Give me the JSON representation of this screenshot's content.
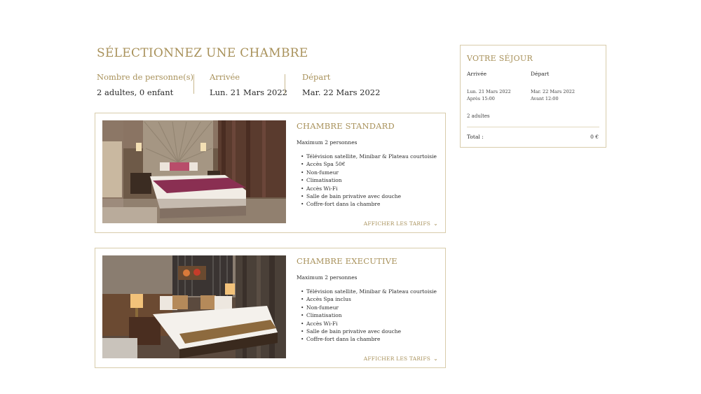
{
  "page": {
    "title": "SÉLECTIONNEZ UNE CHAMBRE"
  },
  "summary": {
    "persons": {
      "label": "Nombre de personne(s)",
      "value": "2 adultes, 0 enfant"
    },
    "arrival": {
      "label": "Arrivée",
      "value": "Lun. 21 Mars 2022"
    },
    "departure": {
      "label": "Départ",
      "value": "Mar. 22 Mars 2022"
    }
  },
  "rooms": [
    {
      "title": "CHAMBRE STANDARD",
      "capacity": "Maximum 2 personnes",
      "amenities": [
        "Télévision satellite, Minibar & Plateau courtoisie",
        "Accès Spa 50€",
        "Non-fumeur",
        "Climatisation",
        "Accès Wi-Fi",
        "Salle de bain privative avec douche",
        "Coffre-fort dans la chambre"
      ],
      "rates_link": "AFFICHER LES TARIFS"
    },
    {
      "title": "CHAMBRE EXECUTIVE",
      "capacity": "Maximum 2 personnes",
      "amenities": [
        "Télévision satellite, Minibar & Plateau courtoisie",
        "Accès Spa inclus",
        "Non-fumeur",
        "Climatisation",
        "Accès Wi-Fi",
        "Salle de bain privative avec douche",
        "Coffre-fort dans la chambre"
      ],
      "rates_link": "AFFICHER LES TARIFS"
    }
  ],
  "stay": {
    "title": "VOTRE SÉJOUR",
    "arrival": {
      "label": "Arrivée",
      "date": "Lun. 21 Mars 2022",
      "time": "Après 15:00"
    },
    "departure": {
      "label": "Départ",
      "date": "Mar. 22 Mars 2022",
      "time": "Avant 12:00"
    },
    "guests": "2 adultes",
    "total_label": "Total :",
    "total_value": "0 €"
  },
  "colors": {
    "accent": "#a8915a",
    "border": "#d8ccab",
    "text": "#2b2b2b"
  },
  "icons": {
    "rates_chevron": "chevron-down-icon"
  }
}
